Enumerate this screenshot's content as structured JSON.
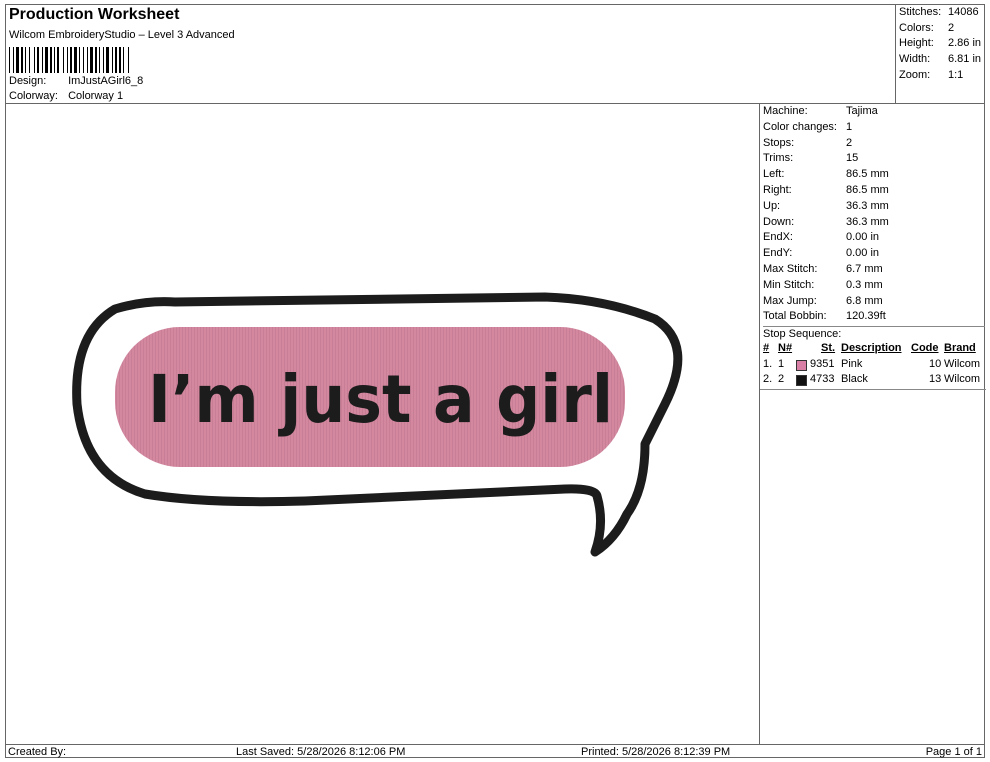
{
  "header": {
    "title": "Production Worksheet",
    "subtitle": "Wilcom EmbroideryStudio – Level 3 Advanced",
    "design_label": "Design:",
    "design_value": "ImJustAGirl6_8",
    "colorway_label": "Colorway:",
    "colorway_value": "Colorway 1"
  },
  "stats": [
    {
      "label": "Stitches:",
      "value": "14086"
    },
    {
      "label": "Colors:",
      "value": "2"
    },
    {
      "label": "Height:",
      "value": "2.86 in"
    },
    {
      "label": "Width:",
      "value": "6.81 in"
    },
    {
      "label": "Zoom:",
      "value": "1:1"
    }
  ],
  "machine_info": [
    {
      "label": "Machine:",
      "value": "Tajima"
    },
    {
      "label": "Color changes:",
      "value": "1"
    },
    {
      "label": "Stops:",
      "value": "2"
    },
    {
      "label": "Trims:",
      "value": "15"
    },
    {
      "label": "Left:",
      "value": "86.5 mm"
    },
    {
      "label": "Right:",
      "value": "86.5 mm"
    },
    {
      "label": "Up:",
      "value": "36.3 mm"
    },
    {
      "label": "Down:",
      "value": "36.3 mm"
    },
    {
      "label": "EndX:",
      "value": "0.00 in"
    },
    {
      "label": "EndY:",
      "value": "0.00 in"
    },
    {
      "label": "Max Stitch:",
      "value": "6.7 mm"
    },
    {
      "label": "Min Stitch:",
      "value": "0.3 mm"
    },
    {
      "label": "Max Jump:",
      "value": "6.8 mm"
    },
    {
      "label": "Total Bobbin:",
      "value": "120.39ft"
    }
  ],
  "stop_sequence": {
    "title": "Stop Sequence:",
    "headers": {
      "num": "#",
      "n": "N#",
      "st": "St.",
      "description": "Description",
      "code": "Code",
      "brand": "Brand"
    },
    "rows": [
      {
        "num": "1.",
        "n": "1",
        "color": "#d97fa6",
        "st": "9351",
        "description": "Pink",
        "code": "10",
        "brand": "Wilcom"
      },
      {
        "num": "2.",
        "n": "2",
        "color": "#111111",
        "st": "4733",
        "description": "Black",
        "code": "13",
        "brand": "Wilcom"
      }
    ]
  },
  "design": {
    "text": "I’m just a girl",
    "pink": "#d3889f",
    "outline": "#1c1c1c"
  },
  "footer": {
    "created_by": "Created By:",
    "last_saved": "Last Saved: 5/28/2026 8:12:06 PM",
    "printed": "Printed: 5/28/2026 8:12:39 PM",
    "page": "Page 1 of 1"
  }
}
